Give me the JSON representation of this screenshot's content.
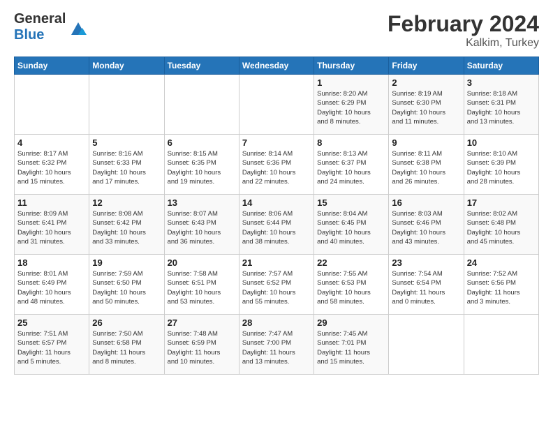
{
  "header": {
    "logo_general": "General",
    "logo_blue": "Blue",
    "title": "February 2024",
    "location": "Kalkim, Turkey"
  },
  "columns": [
    "Sunday",
    "Monday",
    "Tuesday",
    "Wednesday",
    "Thursday",
    "Friday",
    "Saturday"
  ],
  "weeks": [
    [
      {
        "day": "",
        "info": ""
      },
      {
        "day": "",
        "info": ""
      },
      {
        "day": "",
        "info": ""
      },
      {
        "day": "",
        "info": ""
      },
      {
        "day": "1",
        "info": "Sunrise: 8:20 AM\nSunset: 6:29 PM\nDaylight: 10 hours\nand 8 minutes."
      },
      {
        "day": "2",
        "info": "Sunrise: 8:19 AM\nSunset: 6:30 PM\nDaylight: 10 hours\nand 11 minutes."
      },
      {
        "day": "3",
        "info": "Sunrise: 8:18 AM\nSunset: 6:31 PM\nDaylight: 10 hours\nand 13 minutes."
      }
    ],
    [
      {
        "day": "4",
        "info": "Sunrise: 8:17 AM\nSunset: 6:32 PM\nDaylight: 10 hours\nand 15 minutes."
      },
      {
        "day": "5",
        "info": "Sunrise: 8:16 AM\nSunset: 6:33 PM\nDaylight: 10 hours\nand 17 minutes."
      },
      {
        "day": "6",
        "info": "Sunrise: 8:15 AM\nSunset: 6:35 PM\nDaylight: 10 hours\nand 19 minutes."
      },
      {
        "day": "7",
        "info": "Sunrise: 8:14 AM\nSunset: 6:36 PM\nDaylight: 10 hours\nand 22 minutes."
      },
      {
        "day": "8",
        "info": "Sunrise: 8:13 AM\nSunset: 6:37 PM\nDaylight: 10 hours\nand 24 minutes."
      },
      {
        "day": "9",
        "info": "Sunrise: 8:11 AM\nSunset: 6:38 PM\nDaylight: 10 hours\nand 26 minutes."
      },
      {
        "day": "10",
        "info": "Sunrise: 8:10 AM\nSunset: 6:39 PM\nDaylight: 10 hours\nand 28 minutes."
      }
    ],
    [
      {
        "day": "11",
        "info": "Sunrise: 8:09 AM\nSunset: 6:41 PM\nDaylight: 10 hours\nand 31 minutes."
      },
      {
        "day": "12",
        "info": "Sunrise: 8:08 AM\nSunset: 6:42 PM\nDaylight: 10 hours\nand 33 minutes."
      },
      {
        "day": "13",
        "info": "Sunrise: 8:07 AM\nSunset: 6:43 PM\nDaylight: 10 hours\nand 36 minutes."
      },
      {
        "day": "14",
        "info": "Sunrise: 8:06 AM\nSunset: 6:44 PM\nDaylight: 10 hours\nand 38 minutes."
      },
      {
        "day": "15",
        "info": "Sunrise: 8:04 AM\nSunset: 6:45 PM\nDaylight: 10 hours\nand 40 minutes."
      },
      {
        "day": "16",
        "info": "Sunrise: 8:03 AM\nSunset: 6:46 PM\nDaylight: 10 hours\nand 43 minutes."
      },
      {
        "day": "17",
        "info": "Sunrise: 8:02 AM\nSunset: 6:48 PM\nDaylight: 10 hours\nand 45 minutes."
      }
    ],
    [
      {
        "day": "18",
        "info": "Sunrise: 8:01 AM\nSunset: 6:49 PM\nDaylight: 10 hours\nand 48 minutes."
      },
      {
        "day": "19",
        "info": "Sunrise: 7:59 AM\nSunset: 6:50 PM\nDaylight: 10 hours\nand 50 minutes."
      },
      {
        "day": "20",
        "info": "Sunrise: 7:58 AM\nSunset: 6:51 PM\nDaylight: 10 hours\nand 53 minutes."
      },
      {
        "day": "21",
        "info": "Sunrise: 7:57 AM\nSunset: 6:52 PM\nDaylight: 10 hours\nand 55 minutes."
      },
      {
        "day": "22",
        "info": "Sunrise: 7:55 AM\nSunset: 6:53 PM\nDaylight: 10 hours\nand 58 minutes."
      },
      {
        "day": "23",
        "info": "Sunrise: 7:54 AM\nSunset: 6:54 PM\nDaylight: 11 hours\nand 0 minutes."
      },
      {
        "day": "24",
        "info": "Sunrise: 7:52 AM\nSunset: 6:56 PM\nDaylight: 11 hours\nand 3 minutes."
      }
    ],
    [
      {
        "day": "25",
        "info": "Sunrise: 7:51 AM\nSunset: 6:57 PM\nDaylight: 11 hours\nand 5 minutes."
      },
      {
        "day": "26",
        "info": "Sunrise: 7:50 AM\nSunset: 6:58 PM\nDaylight: 11 hours\nand 8 minutes."
      },
      {
        "day": "27",
        "info": "Sunrise: 7:48 AM\nSunset: 6:59 PM\nDaylight: 11 hours\nand 10 minutes."
      },
      {
        "day": "28",
        "info": "Sunrise: 7:47 AM\nSunset: 7:00 PM\nDaylight: 11 hours\nand 13 minutes."
      },
      {
        "day": "29",
        "info": "Sunrise: 7:45 AM\nSunset: 7:01 PM\nDaylight: 11 hours\nand 15 minutes."
      },
      {
        "day": "",
        "info": ""
      },
      {
        "day": "",
        "info": ""
      }
    ]
  ]
}
